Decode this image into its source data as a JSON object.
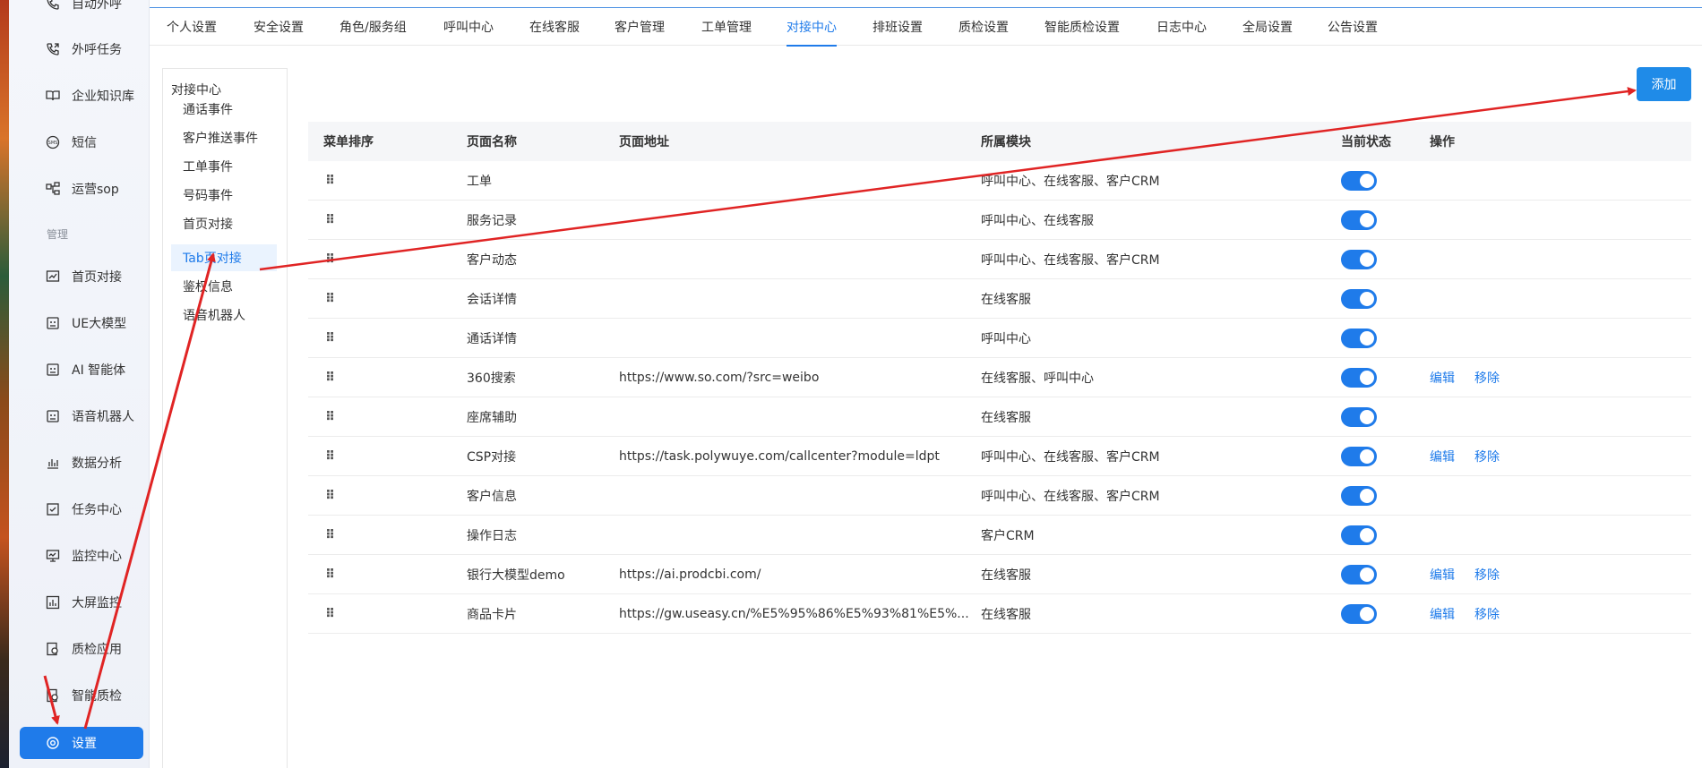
{
  "sidebar": {
    "items": [
      {
        "label": "自动外呼",
        "icon": "phone-icon"
      },
      {
        "label": "外呼任务",
        "icon": "phone-outgoing-icon"
      },
      {
        "label": "企业知识库",
        "icon": "book-icon"
      },
      {
        "label": "短信",
        "icon": "sms-icon"
      },
      {
        "label": "运营sop",
        "icon": "flow-icon"
      }
    ],
    "section_label": "管理",
    "manage_items": [
      {
        "label": "首页对接",
        "icon": "chart-icon"
      },
      {
        "label": "UE大模型",
        "icon": "robot-icon"
      },
      {
        "label": "AI 智能体",
        "icon": "robot-icon"
      },
      {
        "label": "语音机器人",
        "icon": "robot-icon"
      },
      {
        "label": "数据分析",
        "icon": "bar-chart-icon"
      },
      {
        "label": "任务中心",
        "icon": "check-square-icon"
      },
      {
        "label": "监控中心",
        "icon": "monitor-icon"
      },
      {
        "label": "大屏监控",
        "icon": "bar-chart-icon"
      },
      {
        "label": "质检应用",
        "icon": "inspect-icon"
      },
      {
        "label": "智能质检",
        "icon": "inspect-icon"
      }
    ],
    "settings_label": "设置"
  },
  "tabs": [
    "个人设置",
    "安全设置",
    "角色/服务组",
    "呼叫中心",
    "在线客服",
    "客户管理",
    "工单管理",
    "对接中心",
    "排班设置",
    "质检设置",
    "智能质检设置",
    "日志中心",
    "全局设置",
    "公告设置"
  ],
  "active_tab": "对接中心",
  "submenu": {
    "title": "对接中心",
    "items": [
      "通话事件",
      "客户推送事件",
      "工单事件",
      "号码事件",
      "首页对接",
      "Tab页对接",
      "鉴权信息",
      "语音机器人"
    ],
    "active": "Tab页对接"
  },
  "add_button": "添加",
  "table": {
    "headers": {
      "sort": "菜单排序",
      "name": "页面名称",
      "url": "页面地址",
      "module": "所属模块",
      "status": "当前状态",
      "ops": "操作"
    },
    "drag_glyph": "⠿",
    "edit_label": "编辑",
    "remove_label": "移除",
    "rows": [
      {
        "name": "工单",
        "url": "",
        "module": "呼叫中心、在线客服、客户CRM",
        "enabled": true,
        "editable": false
      },
      {
        "name": "服务记录",
        "url": "",
        "module": "呼叫中心、在线客服",
        "enabled": true,
        "editable": false
      },
      {
        "name": "客户动态",
        "url": "",
        "module": "呼叫中心、在线客服、客户CRM",
        "enabled": true,
        "editable": false
      },
      {
        "name": "会话详情",
        "url": "",
        "module": "在线客服",
        "enabled": true,
        "editable": false
      },
      {
        "name": "通话详情",
        "url": "",
        "module": "呼叫中心",
        "enabled": true,
        "editable": false
      },
      {
        "name": "360搜索",
        "url": "https://www.so.com/?src=weibo",
        "module": "在线客服、呼叫中心",
        "enabled": true,
        "editable": true
      },
      {
        "name": "座席辅助",
        "url": "",
        "module": "在线客服",
        "enabled": true,
        "editable": false
      },
      {
        "name": "CSP对接",
        "url": "https://task.polywuye.com/callcenter?module=ldpt",
        "module": "呼叫中心、在线客服、客户CRM",
        "enabled": true,
        "editable": true
      },
      {
        "name": "客户信息",
        "url": "",
        "module": "呼叫中心、在线客服、客户CRM",
        "enabled": true,
        "editable": false
      },
      {
        "name": "操作日志",
        "url": "",
        "module": "客户CRM",
        "enabled": true,
        "editable": false
      },
      {
        "name": "银行大模型demo",
        "url": "https://ai.prodcbi.com/",
        "module": "在线客服",
        "enabled": true,
        "editable": true
      },
      {
        "name": "商品卡片",
        "url": "https://gw.useasy.cn/%E5%95%86%E5%93%81%E5%...",
        "module": "在线客服",
        "enabled": true,
        "editable": true
      }
    ]
  },
  "colors": {
    "accent": "#1f7bea",
    "annotation_arrow": "#e02424"
  }
}
